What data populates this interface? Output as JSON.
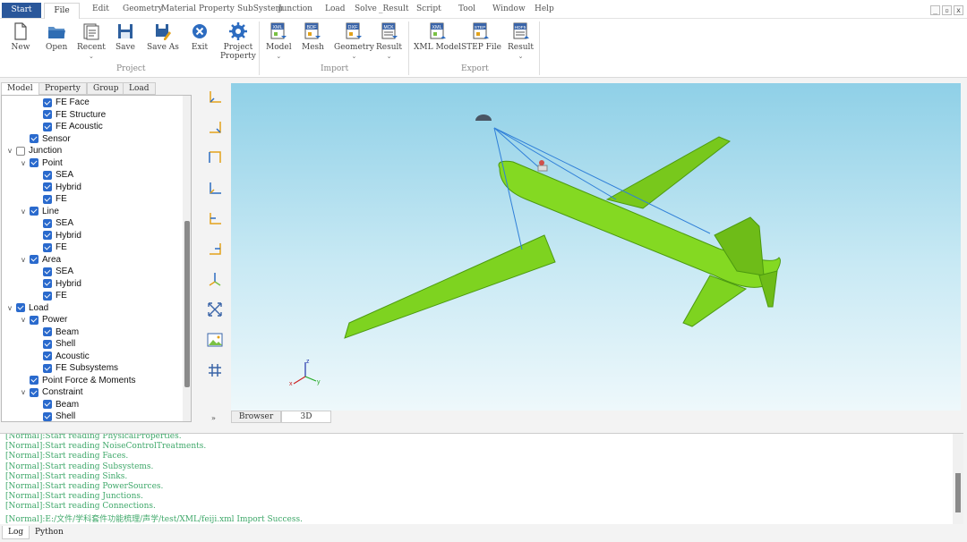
{
  "menubar": {
    "items": [
      "Start",
      "File",
      "Edit",
      "Geometry",
      "Material",
      "Property",
      "SubSystem",
      "Junction",
      "Load",
      "Solve",
      "_Result",
      "Script",
      "Tool",
      "Window",
      "Help"
    ],
    "window_controls": [
      "_",
      "▫",
      "x"
    ]
  },
  "ribbon": {
    "project": {
      "group_label": "Project",
      "new": "New",
      "open": "Open",
      "recent": "Recent",
      "save": "Save",
      "save_as": "Save As",
      "exit": "Exit",
      "project_property_1": "Project",
      "project_property_2": "Property"
    },
    "import": {
      "group_label": "Import",
      "model": "Model",
      "mesh": "Mesh",
      "geometry": "Geometry",
      "result": "Result",
      "icon_model": "XML",
      "icon_mesh": "BDF",
      "icon_geometry": "DXF",
      "icon_result": "MCK"
    },
    "export": {
      "group_label": "Export",
      "xml_model": "XML Model",
      "step_file": "STEP File",
      "result": "Result",
      "icon_xml": "XML",
      "icon_step": "STEP",
      "icon_hdf": "HDF5"
    }
  },
  "left_tabs": [
    "Model",
    "Property",
    "Group",
    "Load"
  ],
  "tree": [
    {
      "label": "FE Face",
      "level": 3,
      "checked": true,
      "expand": ""
    },
    {
      "label": "FE Structure",
      "level": 3,
      "checked": true,
      "expand": ""
    },
    {
      "label": "FE Acoustic",
      "level": 3,
      "checked": true,
      "expand": ""
    },
    {
      "label": "Sensor",
      "level": 2,
      "checked": true,
      "expand": ""
    },
    {
      "label": "Junction",
      "level": 1,
      "checked": false,
      "expand": "v"
    },
    {
      "label": "Point",
      "level": 2,
      "checked": true,
      "expand": "v"
    },
    {
      "label": "SEA",
      "level": 3,
      "checked": true,
      "expand": ""
    },
    {
      "label": "Hybrid",
      "level": 3,
      "checked": true,
      "expand": ""
    },
    {
      "label": "FE",
      "level": 3,
      "checked": true,
      "expand": ""
    },
    {
      "label": "Line",
      "level": 2,
      "checked": true,
      "expand": "v"
    },
    {
      "label": "SEA",
      "level": 3,
      "checked": true,
      "expand": ""
    },
    {
      "label": "Hybrid",
      "level": 3,
      "checked": true,
      "expand": ""
    },
    {
      "label": "FE",
      "level": 3,
      "checked": true,
      "expand": ""
    },
    {
      "label": "Area",
      "level": 2,
      "checked": true,
      "expand": "v"
    },
    {
      "label": "SEA",
      "level": 3,
      "checked": true,
      "expand": ""
    },
    {
      "label": "Hybrid",
      "level": 3,
      "checked": true,
      "expand": ""
    },
    {
      "label": "FE",
      "level": 3,
      "checked": true,
      "expand": ""
    },
    {
      "label": "Load",
      "level": 1,
      "checked": true,
      "expand": "v"
    },
    {
      "label": "Power",
      "level": 2,
      "checked": true,
      "expand": "v"
    },
    {
      "label": "Beam",
      "level": 3,
      "checked": true,
      "expand": ""
    },
    {
      "label": "Shell",
      "level": 3,
      "checked": true,
      "expand": ""
    },
    {
      "label": "Acoustic",
      "level": 3,
      "checked": true,
      "expand": ""
    },
    {
      "label": "FE Subsystems",
      "level": 3,
      "checked": true,
      "expand": ""
    },
    {
      "label": "Point Force & Moments",
      "level": 2,
      "checked": true,
      "expand": ""
    },
    {
      "label": "Constraint",
      "level": 2,
      "checked": true,
      "expand": "v"
    },
    {
      "label": "Beam",
      "level": 3,
      "checked": true,
      "expand": ""
    },
    {
      "label": "Shell",
      "level": 3,
      "checked": true,
      "expand": ""
    }
  ],
  "viewport": {
    "model_color": "#7ed320",
    "background_top": "#8fd0e7",
    "axis_labels": [
      "z",
      "x",
      "y"
    ]
  },
  "view_tabs": [
    "Browser",
    "3D"
  ],
  "expander": "»",
  "log_lines": [
    "[Normal]:Start reading PhysicalProperties.",
    "[Normal]:Start reading NoiseControlTreatments.",
    "[Normal]:Start reading Faces.",
    "[Normal]:Start reading Subsystems.",
    "[Normal]:Start reading Sinks.",
    "[Normal]:Start reading PowerSources.",
    "[Normal]:Start reading Junctions.",
    "[Normal]:Start reading Connections.",
    "[Normal]:E:/文件/学科套件功能梳理/声学/test/XML/feiji.xml Import Success."
  ],
  "bottom_tabs": [
    "Log",
    "Python"
  ]
}
